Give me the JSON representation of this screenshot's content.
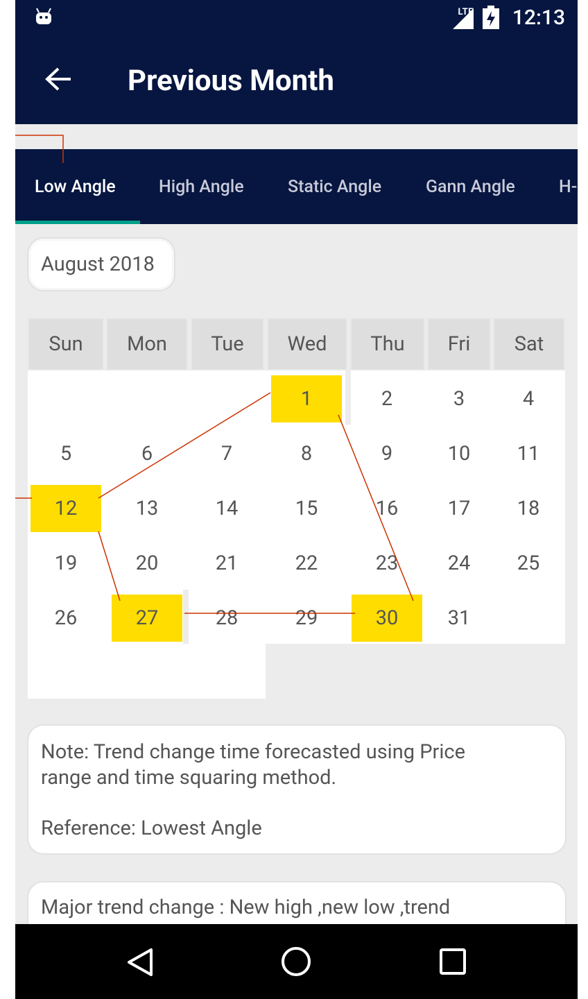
{
  "status_bar": {
    "time": "12:13",
    "network": "LTE"
  },
  "app_bar": {
    "title": "Previous Month"
  },
  "tabs": [
    {
      "label": "Low Angle",
      "active": true
    },
    {
      "label": "High Angle"
    },
    {
      "label": "Static Angle"
    },
    {
      "label": "Gann Angle"
    },
    {
      "label": "H-"
    }
  ],
  "calendar": {
    "month": "August 2018",
    "weekdays": [
      "Sun",
      "Mon",
      "Tue",
      "Wed",
      "Thu",
      "Fri",
      "Sat"
    ],
    "highlight_color": "#ffdd00",
    "highlighted_days": [
      "1",
      "12",
      "27",
      "30"
    ]
  },
  "note_card": {
    "line1": "Note: Trend change time forecasted using Price",
    "line2": "range and time squaring method.",
    "reference": "Reference: Lowest Angle"
  },
  "second_card": {
    "text": "Major trend change : New high ,new low ,trend"
  },
  "colors": {
    "primary": "#061640",
    "accent": "#00a08a",
    "line": "#cc3300"
  }
}
